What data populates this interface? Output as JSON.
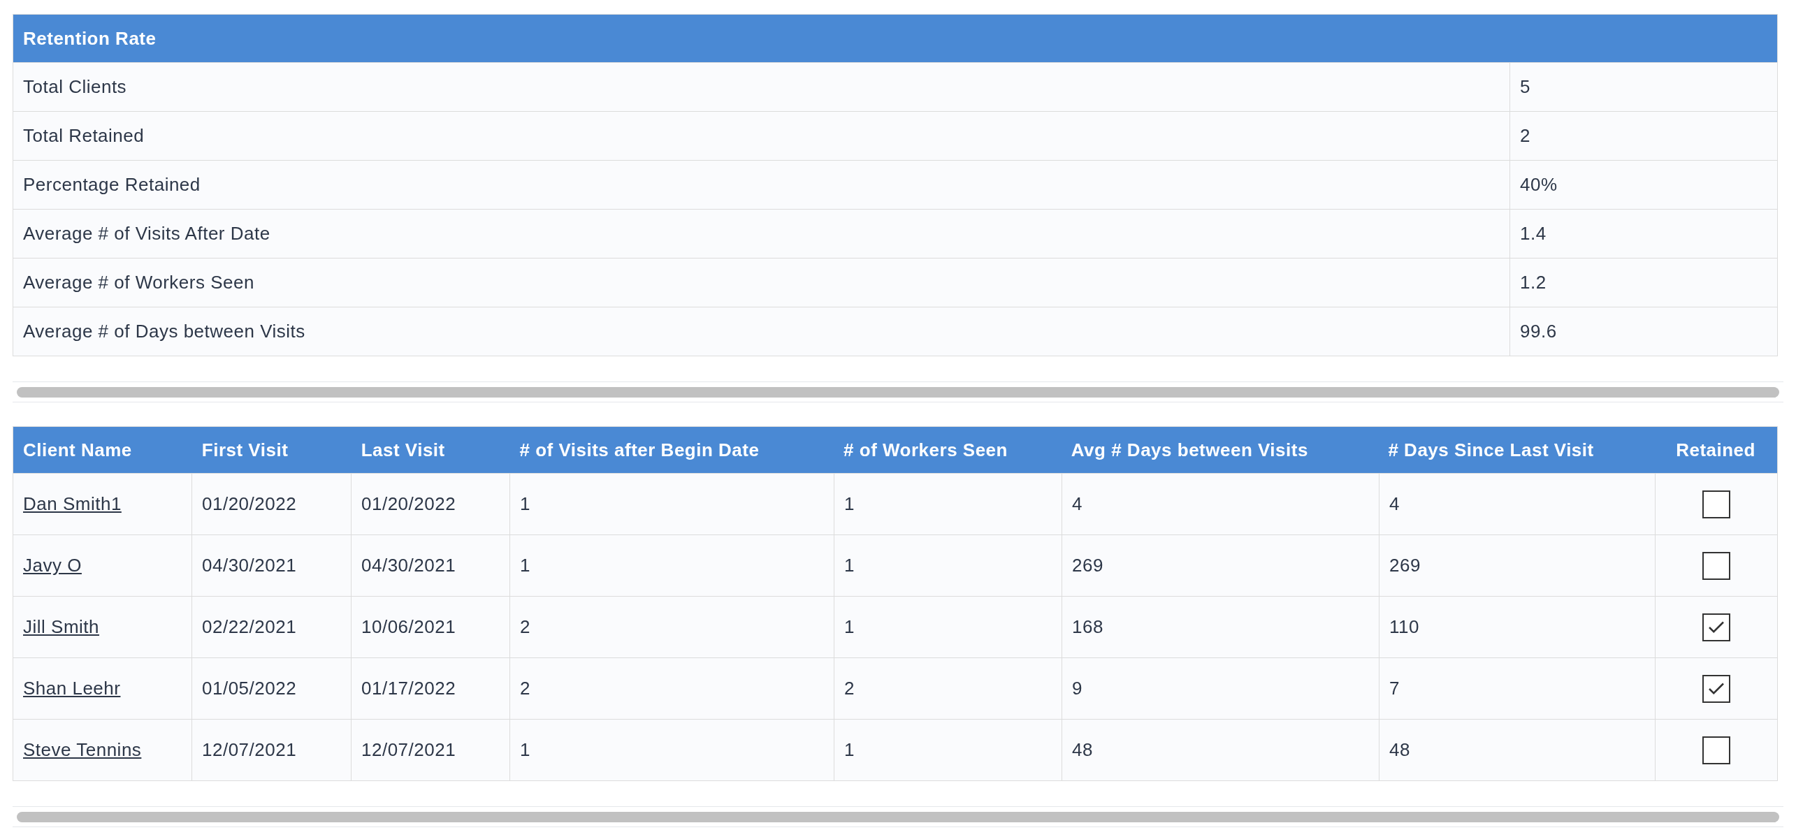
{
  "summary": {
    "title": "Retention Rate",
    "rows": [
      {
        "label": "Total Clients",
        "value": "5"
      },
      {
        "label": "Total Retained",
        "value": "2"
      },
      {
        "label": "Percentage Retained",
        "value": "40%"
      },
      {
        "label": "Average # of Visits After Date",
        "value": "1.4"
      },
      {
        "label": "Average # of Workers Seen",
        "value": "1.2"
      },
      {
        "label": "Average # of Days between Visits",
        "value": "99.6"
      }
    ]
  },
  "clients": {
    "columns": [
      "Client Name",
      "First Visit",
      "Last Visit",
      "# of Visits after Begin Date",
      "# of Workers Seen",
      "Avg # Days between Visits",
      "# Days Since Last Visit",
      "Retained"
    ],
    "rows": [
      {
        "name": "Dan Smith1",
        "first": "01/20/2022",
        "last": "01/20/2022",
        "visits": "1",
        "workers": "1",
        "avg_days": "4",
        "days_since": "4",
        "retained": false
      },
      {
        "name": "Javy O",
        "first": "04/30/2021",
        "last": "04/30/2021",
        "visits": "1",
        "workers": "1",
        "avg_days": "269",
        "days_since": "269",
        "retained": false
      },
      {
        "name": "Jill Smith",
        "first": "02/22/2021",
        "last": "10/06/2021",
        "visits": "2",
        "workers": "1",
        "avg_days": "168",
        "days_since": "110",
        "retained": true
      },
      {
        "name": "Shan Leehr",
        "first": "01/05/2022",
        "last": "01/17/2022",
        "visits": "2",
        "workers": "2",
        "avg_days": "9",
        "days_since": "7",
        "retained": true
      },
      {
        "name": "Steve Tennins",
        "first": "12/07/2021",
        "last": "12/07/2021",
        "visits": "1",
        "workers": "1",
        "avg_days": "48",
        "days_since": "48",
        "retained": false
      }
    ]
  }
}
